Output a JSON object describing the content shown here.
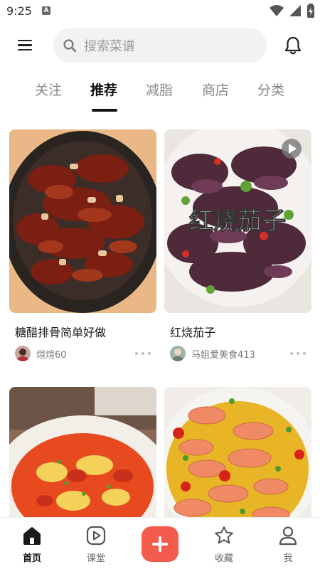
{
  "status_bar": {
    "time": "9:25",
    "notification_badge": "A",
    "icons": [
      "wifi-icon",
      "cell-signal-icon",
      "battery-icon"
    ]
  },
  "header": {
    "search_placeholder": "搜索菜谱",
    "icons": [
      "menu-icon",
      "search-icon",
      "bell-icon"
    ]
  },
  "tabs": [
    {
      "label": "关注",
      "active": false
    },
    {
      "label": "推荐",
      "active": true
    },
    {
      "label": "减脂",
      "active": false
    },
    {
      "label": "商店",
      "active": false
    },
    {
      "label": "分类",
      "active": false
    }
  ],
  "feed": [
    {
      "title": "糖醋排骨简单好做",
      "author": "煊煊60",
      "image_desc": "sweet-and-sour-ribs-photo",
      "has_video": false
    },
    {
      "title": "红烧茄子",
      "author": "马姐爱美食413",
      "image_overlay_text": "红烧茄子",
      "image_desc": "braised-eggplant-photo",
      "has_video": true
    },
    {
      "title": "",
      "author": "",
      "image_desc": "tomato-egg-photo",
      "has_video": false
    },
    {
      "title": "",
      "author": "",
      "image_desc": "shrimp-egg-custard-photo",
      "has_video": false
    }
  ],
  "bottom_nav": [
    {
      "label": "首页",
      "icon": "home-icon",
      "active": true
    },
    {
      "label": "课堂",
      "icon": "play-square-icon",
      "active": false
    },
    {
      "label": "",
      "icon": "plus-icon",
      "active": false
    },
    {
      "label": "收藏",
      "icon": "star-icon",
      "active": false
    },
    {
      "label": "我",
      "icon": "person-icon",
      "active": false
    }
  ],
  "colors": {
    "accent": "#f25a4c",
    "text_primary": "#111111",
    "text_secondary": "#888888",
    "search_bg": "#f2f2f2"
  }
}
